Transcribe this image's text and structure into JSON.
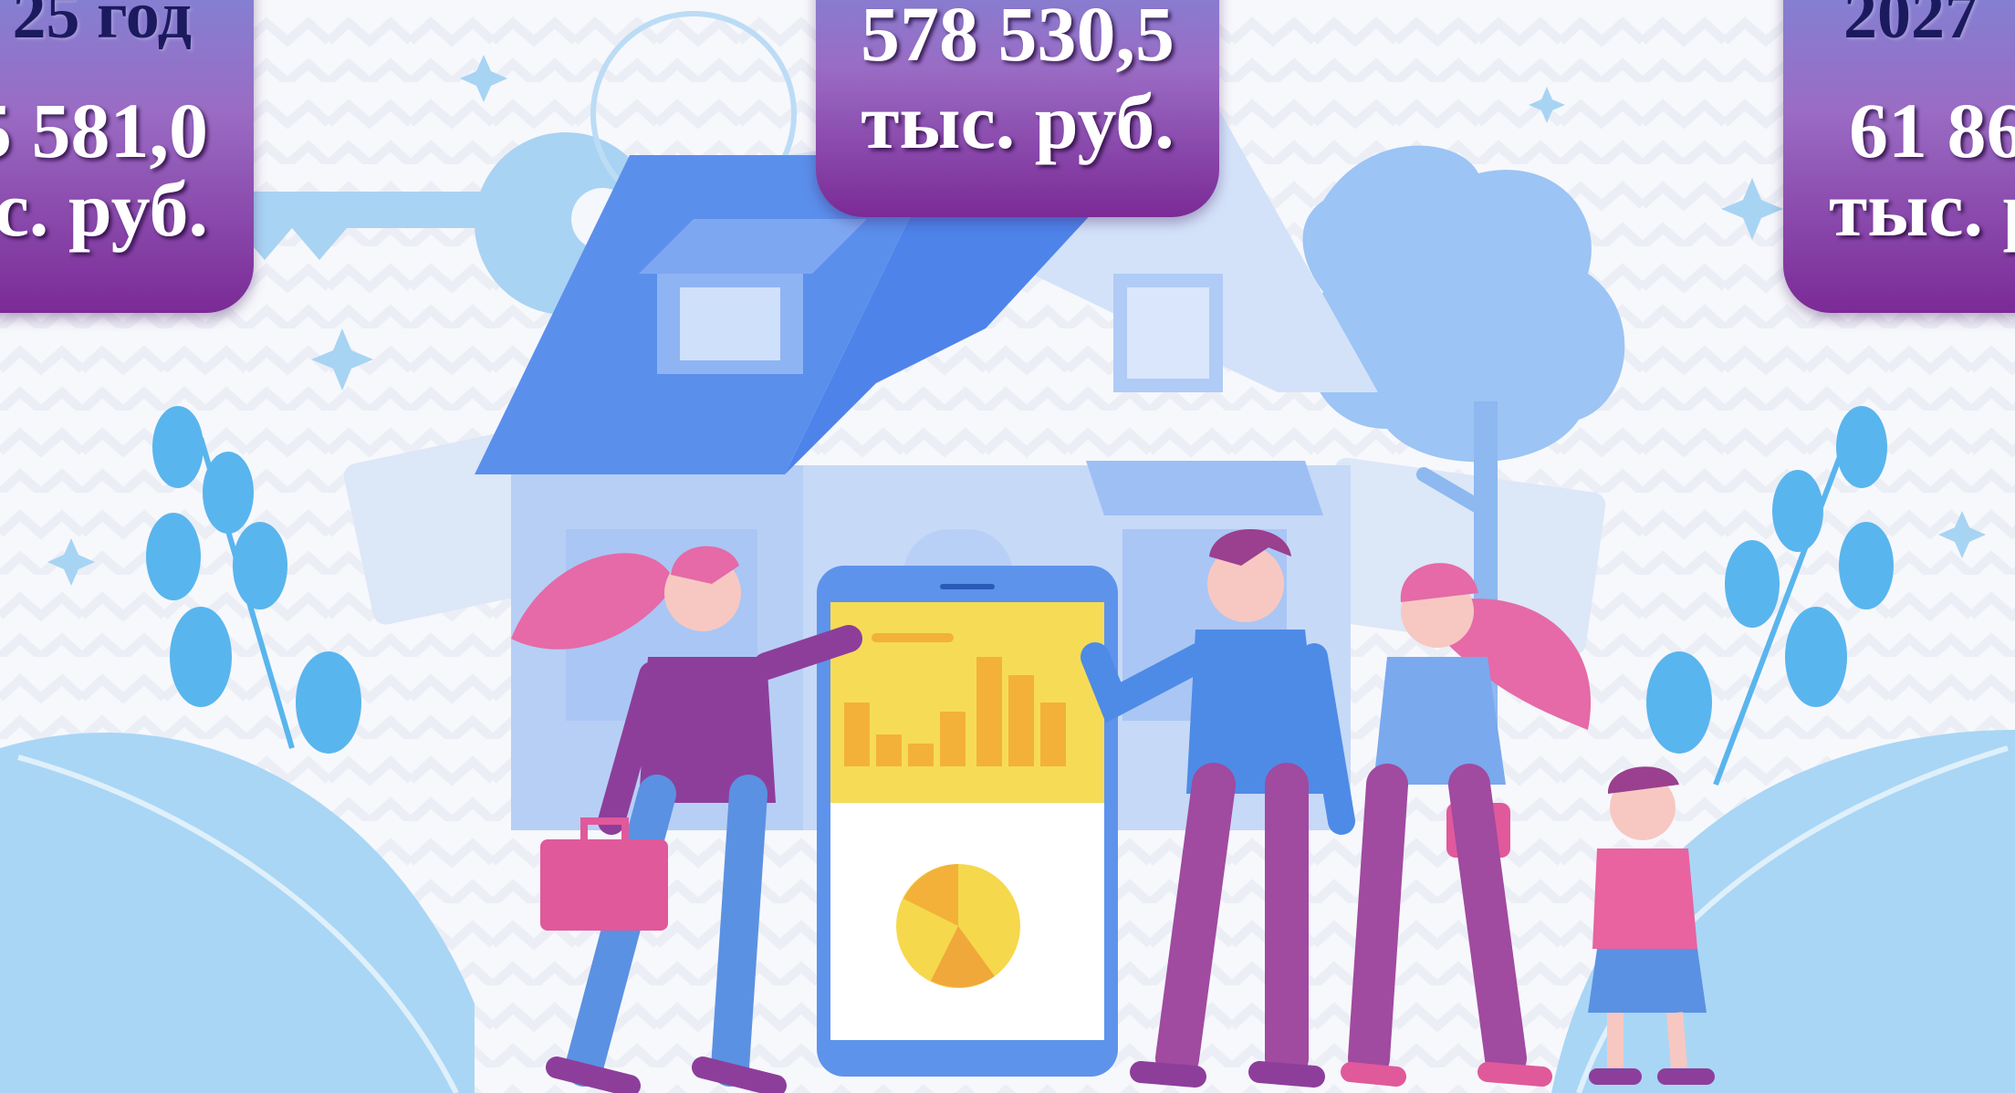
{
  "colors": {
    "card_top": "#7a88d8",
    "card_mid": "#9a6cc4",
    "card_bottom": "#7b2a96",
    "year_text": "#1b1a5e",
    "value_text": "#ffffff"
  },
  "cards": [
    {
      "year": "25 год",
      "amount": "5 581,0",
      "unit": "с. руб."
    },
    {
      "amount": "578 530,5",
      "unit": "тыс. руб."
    },
    {
      "year": "2027",
      "amount": "61 86",
      "unit": "тыс. р"
    }
  ],
  "illustration": {
    "description_icons": [
      "house-icon",
      "key-icon",
      "tree-icon",
      "smartphone-icon",
      "bar-chart-icon",
      "pie-chart-icon",
      "briefcase-icon",
      "handbag-icon",
      "leaf-icon",
      "sparkle-icon"
    ]
  }
}
